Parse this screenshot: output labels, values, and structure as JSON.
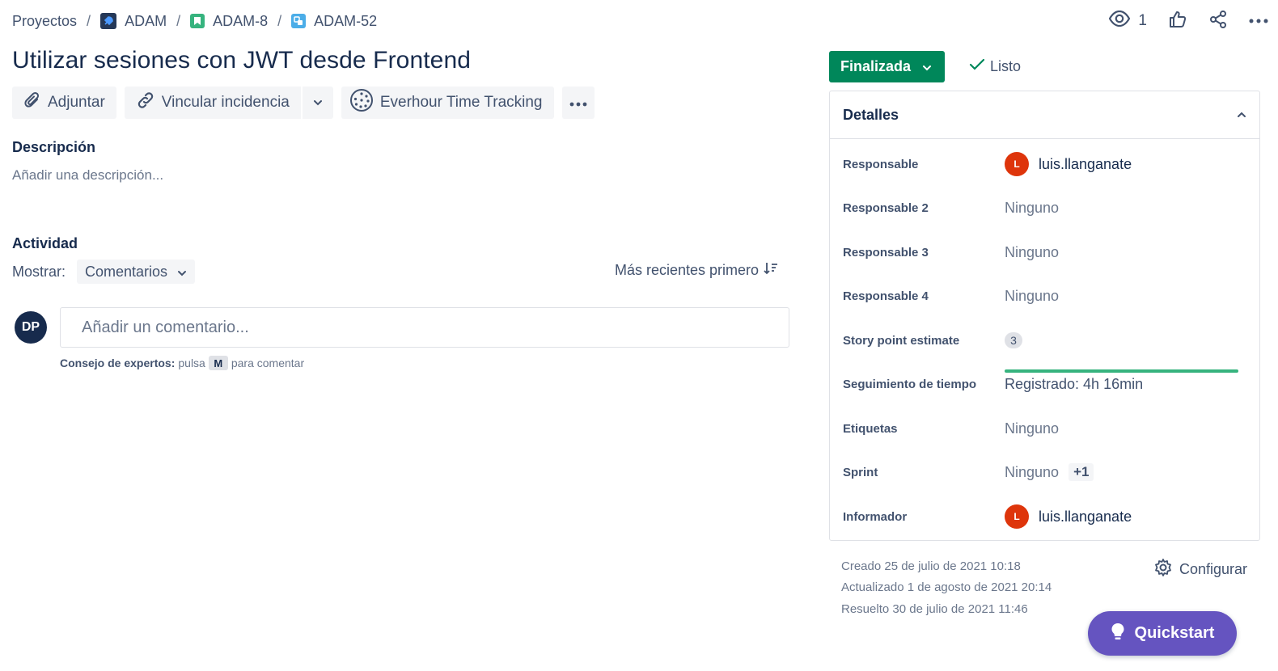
{
  "breadcrumb": {
    "root": "Proyectos",
    "project": "ADAM",
    "epic": "ADAM-8",
    "issue": "ADAM-52"
  },
  "top_actions": {
    "watchers_count": "1"
  },
  "issue": {
    "title": "Utilizar sesiones con JWT desde Frontend"
  },
  "toolbar": {
    "attach_label": "Adjuntar",
    "link_label": "Vincular incidencia",
    "everhour_label": "Everhour Time Tracking"
  },
  "description": {
    "heading": "Descripción",
    "placeholder": "Añadir una descripción..."
  },
  "activity": {
    "heading": "Actividad",
    "show_label": "Mostrar:",
    "show_value": "Comentarios",
    "sort_label": "Más recientes primero",
    "avatar_initials": "DP",
    "comment_placeholder": "Añadir un comentario...",
    "tip_bold": "Consejo de expertos:",
    "tip_pre": "pulsa",
    "tip_key": "M",
    "tip_post": "para comentar"
  },
  "status": {
    "label": "Finalizada",
    "resolution": "Listo",
    "color": "#00875a"
  },
  "details": {
    "heading": "Detalles",
    "fields": {
      "assignee": {
        "label": "Responsable",
        "initial": "L",
        "value": "luis.llanganate"
      },
      "assignee2": {
        "label": "Responsable 2",
        "value": "Ninguno"
      },
      "assignee3": {
        "label": "Responsable 3",
        "value": "Ninguno"
      },
      "assignee4": {
        "label": "Responsable 4",
        "value": "Ninguno"
      },
      "story_points": {
        "label": "Story point estimate",
        "value": "3"
      },
      "time_tracking": {
        "label": "Seguimiento de tiempo",
        "value": "Registrado: 4h 16min",
        "logged_fraction": 1.0
      },
      "labels": {
        "label": "Etiquetas",
        "value": "Ninguno"
      },
      "sprint": {
        "label": "Sprint",
        "value": "Ninguno",
        "extra": "+1"
      },
      "reporter": {
        "label": "Informador",
        "initial": "L",
        "value": "luis.llanganate"
      }
    }
  },
  "meta": {
    "created": "Creado 25 de julio de 2021 10:18",
    "updated": "Actualizado 1 de agosto de 2021 20:14",
    "resolved": "Resuelto 30 de julio de 2021 11:46",
    "configure": "Configurar"
  },
  "quickstart": {
    "label": "Quickstart",
    "color": "#6554c0"
  }
}
